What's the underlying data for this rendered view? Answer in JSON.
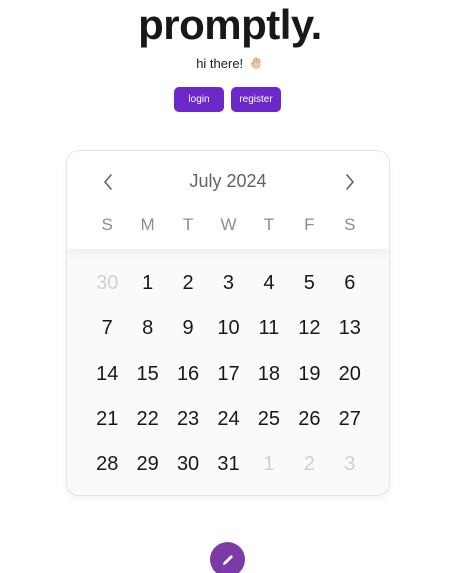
{
  "brand": {
    "name": "promptly."
  },
  "greeting": {
    "text": "hi there!",
    "emoji_icon": "waving-hand-icon"
  },
  "auth": {
    "login_label": "login",
    "register_label": "register"
  },
  "calendar": {
    "month_label": "July 2024",
    "prev_icon": "chevron-left-icon",
    "next_icon": "chevron-right-icon",
    "weekdays": [
      "S",
      "M",
      "T",
      "W",
      "T",
      "F",
      "S"
    ],
    "weeks": [
      [
        {
          "d": "30",
          "muted": true
        },
        {
          "d": "1"
        },
        {
          "d": "2"
        },
        {
          "d": "3"
        },
        {
          "d": "4"
        },
        {
          "d": "5"
        },
        {
          "d": "6"
        }
      ],
      [
        {
          "d": "7"
        },
        {
          "d": "8"
        },
        {
          "d": "9"
        },
        {
          "d": "10"
        },
        {
          "d": "11"
        },
        {
          "d": "12"
        },
        {
          "d": "13"
        }
      ],
      [
        {
          "d": "14"
        },
        {
          "d": "15"
        },
        {
          "d": "16"
        },
        {
          "d": "17"
        },
        {
          "d": "18"
        },
        {
          "d": "19"
        },
        {
          "d": "20"
        }
      ],
      [
        {
          "d": "21"
        },
        {
          "d": "22"
        },
        {
          "d": "23"
        },
        {
          "d": "24"
        },
        {
          "d": "25"
        },
        {
          "d": "26"
        },
        {
          "d": "27"
        }
      ],
      [
        {
          "d": "28"
        },
        {
          "d": "29"
        },
        {
          "d": "30"
        },
        {
          "d": "31"
        },
        {
          "d": "1",
          "muted": true
        },
        {
          "d": "2",
          "muted": true
        },
        {
          "d": "3",
          "muted": true
        }
      ]
    ]
  },
  "fab": {
    "icon": "pencil-icon"
  },
  "colors": {
    "accent": "#6d28c9",
    "fab": "#7c3aa8",
    "text": "#16181c",
    "muted": "#cfd1d4"
  }
}
